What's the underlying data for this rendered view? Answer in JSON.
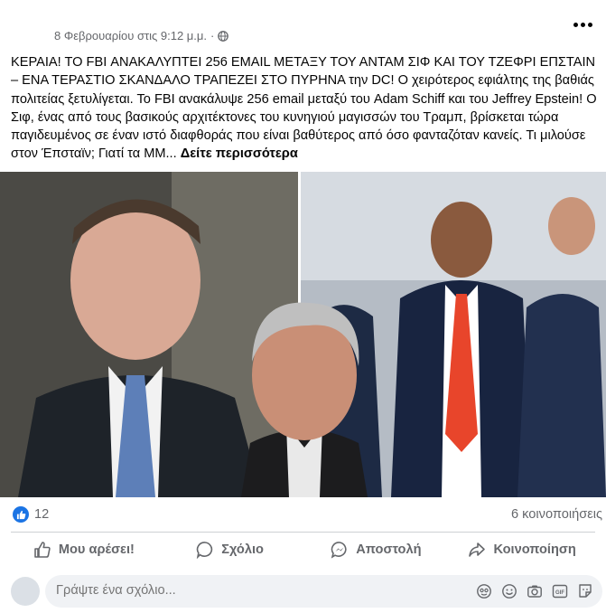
{
  "post": {
    "timestamp": "8 Φεβρουαρίου στις 9:12 μ.μ.",
    "dot": "·",
    "text_main": "ΚΕΡΑΙΑ!  ΤΟ FBI ΑΝΑΚΑΛΥΠΤΕΙ 256 EMAIL ΜΕΤΑΞΥ ΤΟΥ ΑΝΤΑΜ ΣΙΦ ΚΑΙ ΤΟΥ ΤΖΕΦΡΙ ΕΠΣΤΑΙΝ – ΕΝΑ ΤΕΡΑΣΤΙΟ ΣΚΑΝΔΑΛΟ ΤΡΑΠΕΖΕΙ ΣΤΟ ΠΥΡΗΝΑ την DC!  Ο χειρότερος εφιάλτης της βαθιάς πολιτείας ξετυλίγεται.  Το FBI ανακάλυψε 256 email μεταξύ του Adam Schiff και του Jeffrey Epstein!  Ο Σιφ, ένας από τους βασικούς αρχιτέκτονες του κυνηγιού μαγισσών του Τραμπ, βρίσκεται τώρα παγιδευμένος σε έναν ιστό διαφθοράς που είναι βαθύτερος από όσο φανταζόταν κανείς.  Τι μιλούσε στον Έπσταϊν;  Γιατί τα ΜΜ...",
    "see_more": "Δείτε περισσότερα"
  },
  "stats": {
    "like_count": "12",
    "share_count": "6 κοινοποιήσεις"
  },
  "actions": {
    "like": "Μου αρέσει!",
    "comment": "Σχόλιο",
    "send": "Αποστολή",
    "share": "Κοινοποίηση"
  },
  "comment": {
    "placeholder": "Γράψτε ένα σχόλιο..."
  },
  "colors": {
    "brand_blue": "#1b74e4",
    "secondary_text": "#65676b",
    "comment_bg": "#f0f2f5"
  },
  "icons": [
    "globe-icon",
    "more-options-icon",
    "like-badge-icon",
    "thumbs-up-icon",
    "comment-icon",
    "messenger-icon",
    "share-icon",
    "avatar-sticker-icon",
    "emoji-icon",
    "camera-icon",
    "gif-icon",
    "sticker-icon"
  ]
}
